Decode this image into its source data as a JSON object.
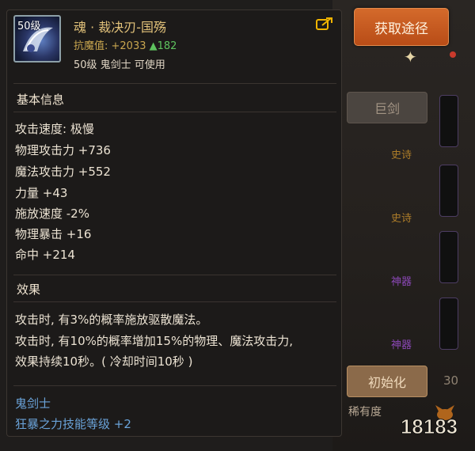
{
  "action": {
    "get_source_label": "获取途径"
  },
  "background": {
    "button_top_label": "巨剑",
    "tags": [
      {
        "text": "史诗",
        "color": "#c48c2b"
      },
      {
        "text": "史诗",
        "color": "#c48c2b"
      },
      {
        "text": "神器",
        "color": "#9d4fd0"
      },
      {
        "text": "神器",
        "color": "#9d4fd0"
      }
    ],
    "init_button_label": "初始化",
    "note": "稀有度",
    "side_number": "30"
  },
  "item": {
    "level_badge": "50级",
    "name": "魂 · 裁决刃-国殇",
    "resist_label": "抗魔值: +2033",
    "resist_increase": "▲182",
    "requirement": "50级 鬼剑士 可使用"
  },
  "basic_info": {
    "heading": "基本信息",
    "stats": [
      "攻击速度: 极慢",
      "物理攻击力 +736",
      "魔法攻击力 +552",
      "力量 +43",
      "施放速度 -2%",
      "物理暴击 +16",
      "命中 +214"
    ]
  },
  "effects": {
    "heading": "效果",
    "lines": [
      "攻击时, 有3%的概率施放驱散魔法。",
      "攻击时, 有10%的概率增加15%的物理、魔法攻击力,",
      "效果持续10秒。( 冷却时间10秒 )"
    ]
  },
  "class_bonus": {
    "class_name": "鬼剑士",
    "skill_bonus": "狂暴之力技能等级 +2"
  },
  "watermark": {
    "text": "18183"
  },
  "colors": {
    "title_gold": "#e2c27a",
    "resist_gold": "#c9a64f",
    "increase_green": "#5ec35e",
    "class_blue": "#6aa3d9",
    "action_orange": "#c8591f"
  }
}
